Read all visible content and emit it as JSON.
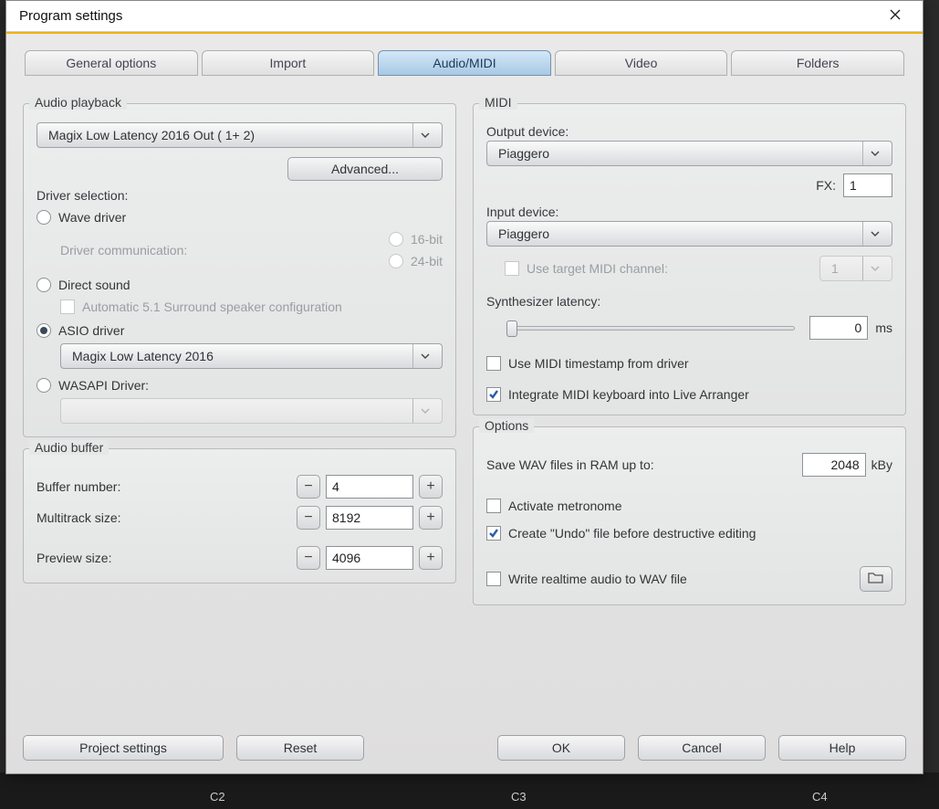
{
  "window": {
    "title": "Program settings"
  },
  "tabs": {
    "general": "General options",
    "import": "Import",
    "audiomidi": "Audio/MIDI",
    "video": "Video",
    "folders": "Folders"
  },
  "audio_playback": {
    "legend": "Audio playback",
    "output_device": "Magix Low Latency 2016 Out ( 1+ 2)",
    "advanced_btn": "Advanced...",
    "driver_selection_label": "Driver selection:",
    "drivers": {
      "wave": "Wave driver",
      "direct": "Direct sound",
      "asio": "ASIO driver",
      "wasapi": "WASAPI Driver:"
    },
    "driver_comm_label": "Driver communication:",
    "bit16": "16-bit",
    "bit24": "24-bit",
    "auto51": "Automatic 5.1 Surround speaker configuration",
    "asio_device": "Magix Low Latency 2016",
    "wasapi_device": ""
  },
  "audio_buffer": {
    "legend": "Audio buffer",
    "buffer_number_label": "Buffer number:",
    "buffer_number": "4",
    "multitrack_label": "Multitrack size:",
    "multitrack": "8192",
    "preview_label": "Preview size:",
    "preview": "4096"
  },
  "midi": {
    "legend": "MIDI",
    "output_label": "Output device:",
    "output_device": "Piaggero",
    "fx_label": "FX:",
    "fx_value": "1",
    "input_label": "Input device:",
    "input_device": "Piaggero",
    "use_target_label": "Use target MIDI channel:",
    "target_channel": "1",
    "synth_latency_label": "Synthesizer latency:",
    "synth_latency": "0",
    "latency_unit": "ms",
    "use_timestamp": "Use MIDI timestamp from driver",
    "integrate_keyboard": "Integrate MIDI keyboard into Live Arranger"
  },
  "options": {
    "legend": "Options",
    "save_wav_label": "Save WAV files in RAM up to:",
    "save_wav_value": "2048",
    "save_wav_unit": "kBy",
    "metronome": "Activate metronome",
    "undo_file": "Create \"Undo\" file before destructive editing",
    "write_realtime": "Write realtime audio to WAV file"
  },
  "footer": {
    "project_settings": "Project settings",
    "reset": "Reset",
    "ok": "OK",
    "cancel": "Cancel",
    "help": "Help"
  },
  "notes": {
    "c2": "C2",
    "c3": "C3",
    "c4": "C4"
  }
}
